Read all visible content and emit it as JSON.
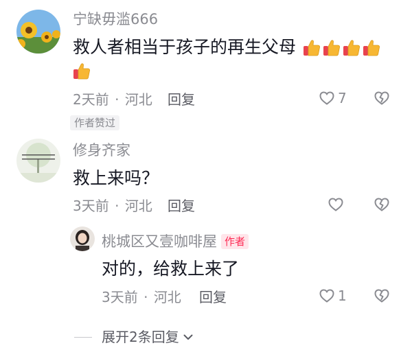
{
  "comments": [
    {
      "username": "宁缺毋滥666",
      "text": "救人者相当于孩子的再生父母",
      "emoji_count": 5,
      "emoji_icon": "thumbs-up-icon",
      "time": "2天前",
      "separator": "·",
      "location": "河北",
      "reply_label": "回复",
      "likes": "7",
      "author_liked_label": "作者赞过"
    },
    {
      "username": "修身齐家",
      "text": "救上来吗？",
      "time": "3天前",
      "separator": "·",
      "location": "河北",
      "reply_label": "回复",
      "likes": ""
    }
  ],
  "reply": {
    "username": "桃城区又壹咖啡屋",
    "author_tag": "作者",
    "text": "对的，给救上来了",
    "time": "3天前",
    "separator": "·",
    "location": "河北",
    "reply_label": "回复",
    "likes": "1"
  },
  "expand_label": "展开2条回复",
  "colors": {
    "meta_gray": "#8a8b91",
    "author_tag_red": "#fe2c55",
    "thumb_yellow": "#f7b733"
  }
}
